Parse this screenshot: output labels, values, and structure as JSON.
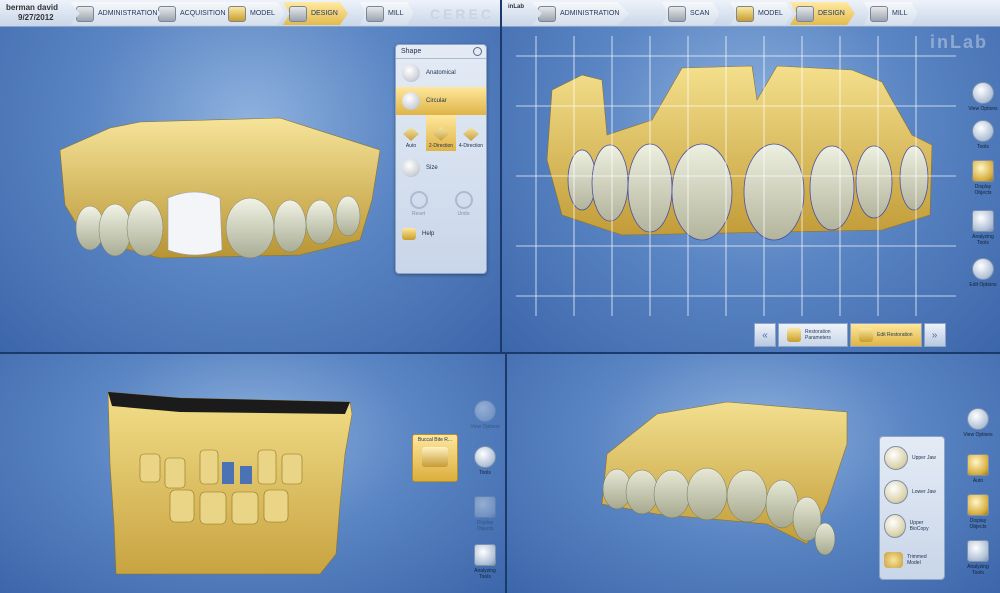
{
  "q1": {
    "patient_name": "berman david",
    "patient_date": "9/27/2012",
    "steps": [
      {
        "label": "ADMINISTRATION",
        "icon": "administration-icon"
      },
      {
        "label": "ACQUISITION",
        "icon": "acquisition-icon"
      },
      {
        "label": "MODEL",
        "icon": "model-icon"
      },
      {
        "label": "DESIGN",
        "icon": "design-icon",
        "active": true
      },
      {
        "label": "MILL",
        "icon": "mill-icon"
      }
    ],
    "brand": "CEREC",
    "shape_panel": {
      "title": "Shape",
      "anatomical": "Anatomical",
      "circular": "Circular",
      "auto": "Auto",
      "two_direction": "2-Direction",
      "four_direction": "4-Direction",
      "size": "Size",
      "reset": "Reset",
      "undo": "Undo",
      "help": "Help"
    }
  },
  "q2": {
    "title": "inLab",
    "steps": [
      {
        "label": "ADMINISTRATION",
        "icon": "administration-icon"
      },
      {
        "label": "SCAN",
        "icon": "scan-icon"
      },
      {
        "label": "MODEL",
        "icon": "model-icon"
      },
      {
        "label": "DESIGN",
        "icon": "design-icon",
        "active": true
      },
      {
        "label": "MILL",
        "icon": "mill-icon"
      }
    ],
    "brand": "inLab",
    "side_tools": [
      "View Options",
      "Tools",
      "Display Objects",
      "Analyzing Tools",
      "Edit Options"
    ],
    "bottom_nav": {
      "restoration_parameters": "Restoration Parameters",
      "edit_restoration": "Edit Restoration"
    }
  },
  "q3": {
    "buccal_label": "Buccal Bite R...",
    "side_tools": [
      "View Options",
      "Tools",
      "Display Objects",
      "Analyzing Tools"
    ]
  },
  "q4": {
    "side_tools": [
      "View Options",
      "Auto",
      "Display Objects",
      "Analyzing Tools"
    ],
    "panel": [
      "Upper Jaw",
      "Lower Jaw",
      "Upper BioCopy",
      "Trimmed Model"
    ]
  },
  "colors": {
    "accent_gold": "#deb447",
    "viewport_blue": "#5b86c4",
    "model_gold": "#e3c764",
    "tooth_white": "#e8ead8"
  }
}
